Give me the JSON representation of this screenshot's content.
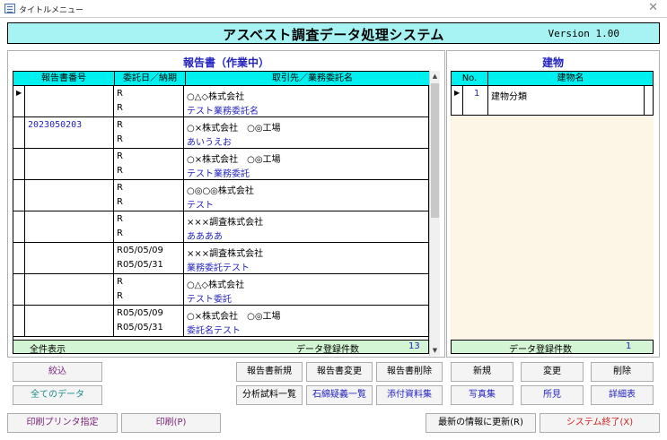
{
  "window": {
    "title": "タイトルメニュー"
  },
  "header": {
    "title": "アスベスト調査データ処理システム",
    "version": "Version 1.00"
  },
  "reports": {
    "title": "報告書（作業中）",
    "columns": [
      "報告書番号",
      "委託日／納期",
      "取引先／業務委託名"
    ],
    "rows": [
      {
        "number": "",
        "date1": "R",
        "date2": "R",
        "client": "○△◇株式会社",
        "task": "テスト業務委託名"
      },
      {
        "number": "2023050203",
        "date1": "R",
        "date2": "R",
        "client": "○×株式会社　○◎工場",
        "task": "あいうえお"
      },
      {
        "number": "",
        "date1": "R",
        "date2": "R",
        "client": "○×株式会社　○◎工場",
        "task": "テスト業務委託"
      },
      {
        "number": "",
        "date1": "R",
        "date2": "R",
        "client": "○◎○◎株式会社",
        "task": "テスト"
      },
      {
        "number": "",
        "date1": "R",
        "date2": "R",
        "client": "×××調査株式会社",
        "task": "ああああ"
      },
      {
        "number": "",
        "date1": "R05/05/09",
        "date2": "R05/05/31",
        "client": "×××調査株式会社",
        "task": "業務委託テスト"
      },
      {
        "number": "",
        "date1": "R",
        "date2": "R",
        "client": "○△◇株式会社",
        "task": "テスト委託"
      },
      {
        "number": "",
        "date1": "R05/05/09",
        "date2": "R05/05/31",
        "client": "○×株式会社　○◎工場",
        "task": "委託名テスト"
      }
    ],
    "footer": {
      "filter": "全件表示",
      "count_label": "データ登録件数",
      "count": "13"
    },
    "buttons": {
      "narrow": "絞込",
      "all_data": "全てのデータ",
      "new_report": "報告書新規",
      "edit_report": "報告書変更",
      "delete_report": "報告書削除",
      "sample_list": "分析試料一覧",
      "asbestos_list": "石綿疑義一覧",
      "attachments": "添付資料集"
    }
  },
  "buildings": {
    "title": "建物",
    "columns": [
      "No.",
      "建物名"
    ],
    "rows": [
      {
        "no": "1",
        "name": "建物分類"
      }
    ],
    "footer": {
      "count_label": "データ登録件数",
      "count": "1"
    },
    "buttons": {
      "new": "新規",
      "edit": "変更",
      "delete": "削除",
      "photos": "写真集",
      "findings": "所見",
      "details": "詳細表"
    }
  },
  "bottom": {
    "printer": "印刷プリンタ指定",
    "print": "印刷(P)",
    "refresh": "最新の情報に更新(R)",
    "exit": "システム終了(X)"
  }
}
